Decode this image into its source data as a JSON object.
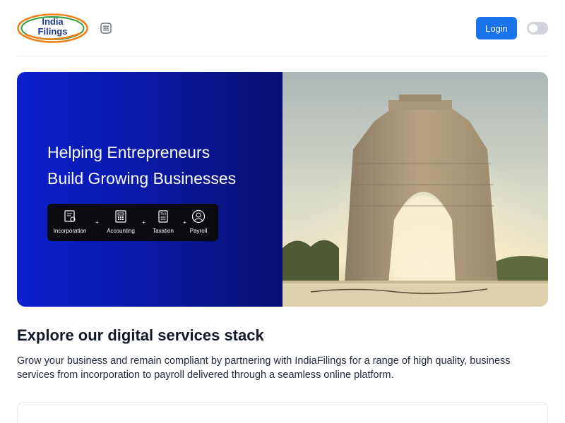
{
  "header": {
    "logo_line1": "India",
    "logo_line2": "Filings",
    "apps_icon": "grid-apps-icon",
    "login_label": "Login",
    "theme_toggle": "dark-mode-toggle",
    "accent_color": "#1a73e8"
  },
  "hero": {
    "title_line1": "Helping Entrepreneurs",
    "title_line2": "Build Growing Businesses",
    "services": [
      {
        "label": "Incorporation",
        "icon": "certificate-icon"
      },
      {
        "label": "Accounting",
        "icon": "ledger-icon"
      },
      {
        "label": "Taxation",
        "icon": "tax-document-icon"
      },
      {
        "label": "Payroll",
        "icon": "employee-icon"
      }
    ],
    "separator": "+",
    "image": "india-gate-photo"
  },
  "section": {
    "title": "Explore our digital services stack",
    "description": "Grow your business and remain compliant by partnering with IndiaFilings for a range of high quality, business services from incorporation to payroll delivered through a seamless online platform."
  }
}
